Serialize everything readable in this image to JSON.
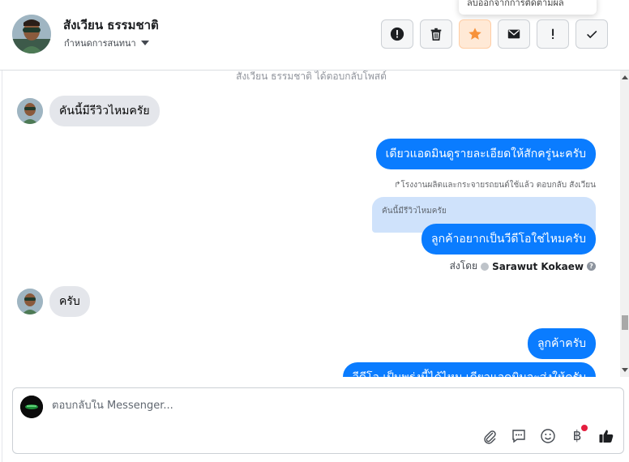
{
  "header": {
    "user_name": "สังเวียน ธรรมชาติ",
    "assign_label": "กำหนดการสนทนา",
    "tooltip": "ลบออกจากการติดตามผล"
  },
  "chat": {
    "system_note": "สังเวียน ธรรมชาติ ได้ตอบกลับโพสต์",
    "msg1": "คันนี้มีรีวิวไหมครัย",
    "msg2": "เดียวแอดมินดูรายละเอียดให้สักครู่นะครับ",
    "reply_meta": "โรงงานผลิตและกระจายรถยนต์ใช้แล้ว ตอบกลับ สังเวียน",
    "quote": "คันนี้มีรีวิวไหมครัย",
    "msg3": "ลูกค้าอยากเป็นวีดีโอใช่ไหมครับ",
    "sent_by_label": "ส่งโดย",
    "sent_by_name": "Sarawut Kokaew",
    "msg4": "ครับ",
    "msg5": "ลูกค้าครับ",
    "msg6": "วีดีโอ เป็นพรุ่งนี้ได้ไหม เดียวแอดมินจะส่งให้ครับ"
  },
  "composer": {
    "placeholder": "ตอบกลับใน Messenger..."
  },
  "icons": {
    "action_buttons": [
      "alert-circle-icon",
      "trash-icon",
      "star-icon",
      "envelope-icon",
      "exclamation-icon",
      "check-icon"
    ],
    "composer_tools": [
      "paperclip-icon",
      "saved-reply-icon",
      "emoji-icon",
      "baht-icon",
      "like-icon"
    ]
  },
  "colors": {
    "accent": "#0a7cff",
    "star": "#f7923a",
    "incoming_bubble": "#e4e6eb",
    "quote_bg": "#cfe2fb",
    "badge": "#e41e3f"
  }
}
